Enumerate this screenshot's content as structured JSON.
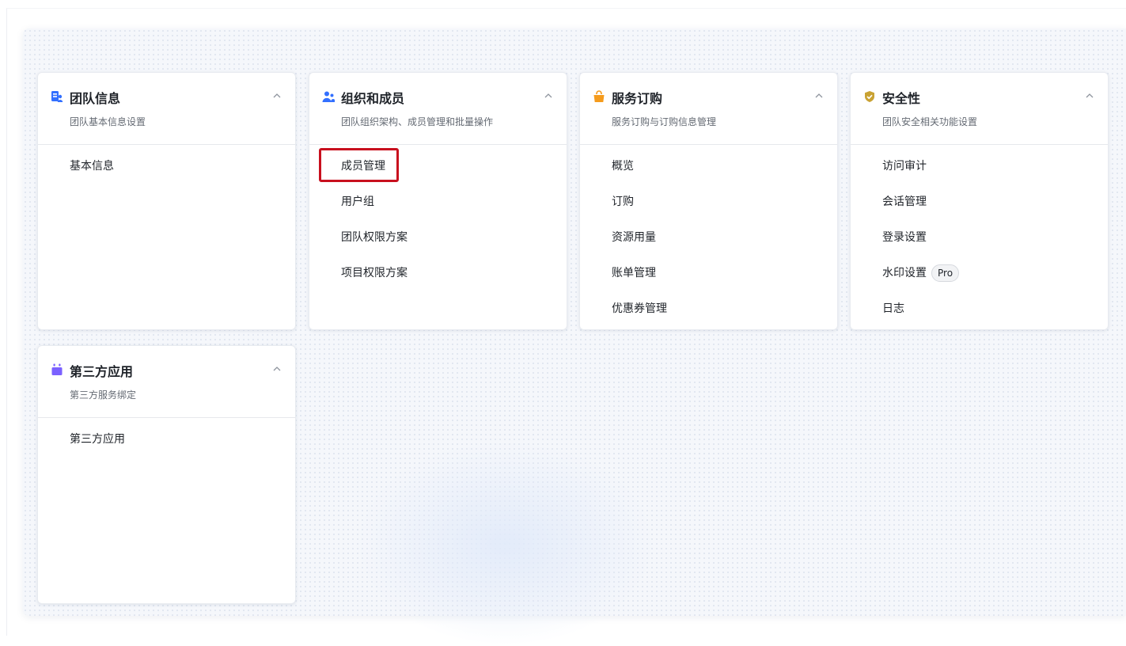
{
  "cards": [
    {
      "title": "团队信息",
      "subtitle": "团队基本信息设置",
      "icon": "team-info-icon",
      "items": [
        {
          "label": "基本信息"
        }
      ]
    },
    {
      "title": "组织和成员",
      "subtitle": "团队组织架构、成员管理和批量操作",
      "icon": "members-icon",
      "items": [
        {
          "label": "成员管理",
          "highlighted": true
        },
        {
          "label": "用户组"
        },
        {
          "label": "团队权限方案"
        },
        {
          "label": "项目权限方案"
        }
      ]
    },
    {
      "title": "服务订购",
      "subtitle": "服务订购与订购信息管理",
      "icon": "shopping-bag-icon",
      "items": [
        {
          "label": "概览"
        },
        {
          "label": "订购"
        },
        {
          "label": "资源用量"
        },
        {
          "label": "账单管理"
        },
        {
          "label": "优惠券管理"
        }
      ]
    },
    {
      "title": "安全性",
      "subtitle": "团队安全相关功能设置",
      "icon": "shield-icon",
      "items": [
        {
          "label": "访问审计"
        },
        {
          "label": "会话管理"
        },
        {
          "label": "登录设置"
        },
        {
          "label": "水印设置",
          "badge": "Pro"
        },
        {
          "label": "日志"
        }
      ]
    },
    {
      "title": "第三方应用",
      "subtitle": "第三方服务绑定",
      "icon": "apps-icon",
      "items": [
        {
          "label": "第三方应用"
        }
      ]
    }
  ],
  "colors": {
    "blue": "#3370ff",
    "orange": "#f59b1c",
    "gold": "#c9a233",
    "purple": "#7b61ff",
    "highlight": "#c8101e"
  }
}
